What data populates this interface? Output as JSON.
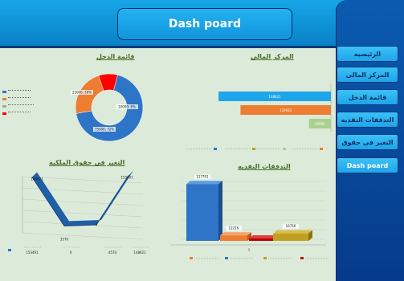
{
  "header": {
    "title": "Dash poard"
  },
  "sidebar": {
    "items": [
      {
        "label": "الرئيسيه"
      },
      {
        "label": "المركز المالى"
      },
      {
        "label": "قائمة الدخل"
      },
      {
        "label": "التدفقات النقديه"
      },
      {
        "label": "التغير فى حقوق"
      },
      {
        "label": "Dash poard"
      }
    ]
  },
  "charts": {
    "income": {
      "title": "قائمة الدخل"
    },
    "financial": {
      "title": "المركز المالى"
    },
    "equity": {
      "title": "التغير فى حقوق الملكيه"
    },
    "cash": {
      "title": "التدفقات النقديه"
    }
  },
  "chart_data": [
    {
      "type": "pie",
      "title": "قائمة الدخل",
      "labels": [
        "",
        "",
        "",
        ""
      ],
      "values": [
        75000,
        25000,
        0,
        10000
      ],
      "slice_labels": [
        "75000; 72%",
        "25000; 16%",
        "",
        "10000; 6%"
      ],
      "colors": [
        "#2e75c8",
        "#ed7d31",
        "#a5a5a5",
        "#ff0000"
      ]
    },
    {
      "type": "bar",
      "title": "المركز المالى",
      "orientation": "horizontal",
      "values": [
        148621,
        119621,
        29000
      ],
      "labels": [
        "148621",
        "119621",
        "29000"
      ],
      "colors": [
        "#1ea5ea",
        "#ed7d31",
        "#a9d18e"
      ]
    },
    {
      "type": "area",
      "title": "التغير فى حقوق الملكيه",
      "values": [
        148621,
        -3570,
        0,
        153491
      ],
      "labels": [
        "148621",
        "3570",
        "0",
        "153491"
      ],
      "table_values": [
        "148621",
        "4570",
        "0",
        "153491"
      ],
      "colors": [
        "#2e75c8"
      ]
    },
    {
      "type": "bar",
      "title": "التدفقات النقديه",
      "values": [
        127791,
        12216,
        4000,
        16756
      ],
      "labels": [
        "127791",
        "12216",
        "",
        "16756"
      ],
      "colors": [
        "#2e75c8",
        "#ed7d31",
        "#c00000",
        "#bfa020"
      ],
      "xtick": "1"
    }
  ]
}
